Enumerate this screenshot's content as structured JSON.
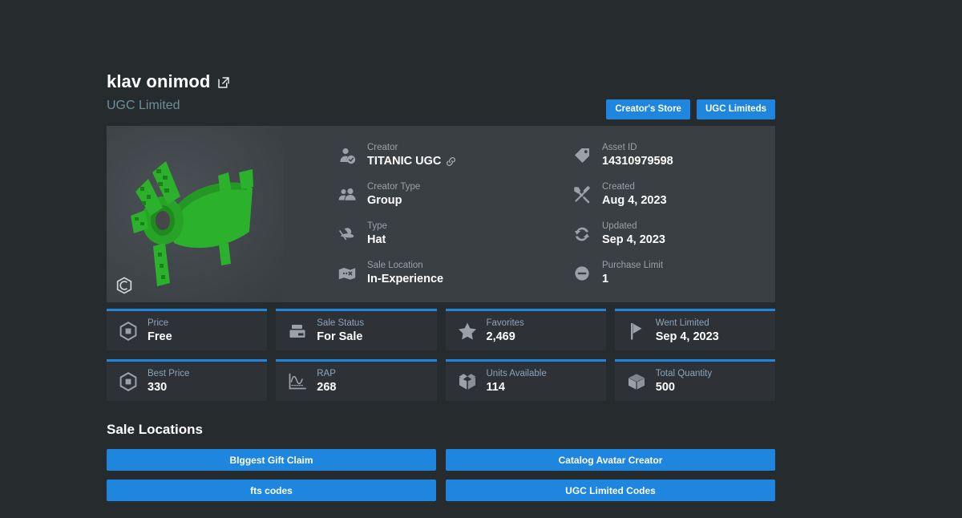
{
  "header": {
    "title": "klav onimod",
    "external_link_icon": "external-link-icon",
    "subtitle": "UGC Limited",
    "buttons": [
      {
        "label": "Creator's Store"
      },
      {
        "label": "UGC Limiteds"
      }
    ]
  },
  "thumbnail": {
    "watermark_icon": "hex-c-logo-icon",
    "item_color": "#2bb12b"
  },
  "info": {
    "left": [
      {
        "icon": "user-verified-icon",
        "label": "Creator",
        "value": "TITANIC UGC",
        "trailing_icon": "link-icon"
      },
      {
        "icon": "group-icon",
        "label": "Creator Type",
        "value": "Group"
      },
      {
        "icon": "hat-icon",
        "label": "Type",
        "value": "Hat"
      },
      {
        "icon": "map-icon",
        "label": "Sale Location",
        "value": "In-Experience"
      }
    ],
    "right": [
      {
        "icon": "tag-icon",
        "label": "Asset ID",
        "value": "14310979598"
      },
      {
        "icon": "tools-icon",
        "label": "Created",
        "value": "Aug 4, 2023"
      },
      {
        "icon": "refresh-icon",
        "label": "Updated",
        "value": "Sep 4, 2023"
      },
      {
        "icon": "minus-circle-icon",
        "label": "Purchase Limit",
        "value": "1"
      }
    ]
  },
  "stats": [
    {
      "icon": "robux-icon",
      "label": "Price",
      "value": "Free"
    },
    {
      "icon": "sale-status-icon",
      "label": "Sale Status",
      "value": "For Sale"
    },
    {
      "icon": "star-icon",
      "label": "Favorites",
      "value": "2,469"
    },
    {
      "icon": "flag-icon",
      "label": "Went Limited",
      "value": "Sep 4, 2023"
    },
    {
      "icon": "robux-icon",
      "label": "Best Price",
      "value": "330"
    },
    {
      "icon": "chart-icon",
      "label": "RAP",
      "value": "268"
    },
    {
      "icon": "open-box-icon",
      "label": "Units Available",
      "value": "114"
    },
    {
      "icon": "box-icon",
      "label": "Total Quantity",
      "value": "500"
    }
  ],
  "sale_locations": {
    "title": "Sale Locations",
    "items": [
      {
        "label": "BIggest Gift Claim"
      },
      {
        "label": "Catalog Avatar Creator"
      },
      {
        "label": "fts codes"
      },
      {
        "label": "UGC Limited Codes"
      }
    ]
  },
  "colors": {
    "background": "#262b2e",
    "panel": "#3a3f43",
    "card": "#2e3236",
    "accent": "#1f86e0",
    "subtitle": "#6d8f9e",
    "stat_label": "#8aa4bd",
    "info_label": "#9aa0a5"
  }
}
